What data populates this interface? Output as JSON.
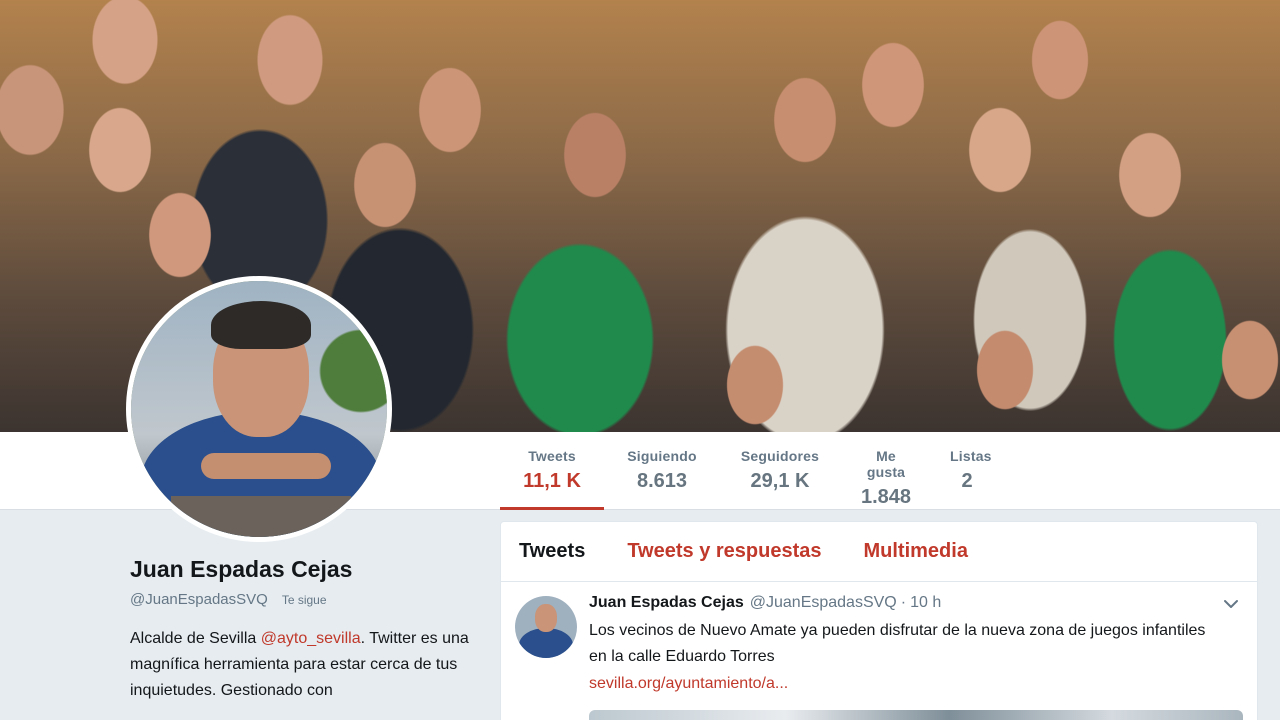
{
  "profile": {
    "name": "Juan Espadas Cejas",
    "handle": "@JuanEspadasSVQ",
    "follows_you": "Te sigue",
    "bio_prefix": "Alcalde de Sevilla ",
    "bio_mention": "@ayto_sevilla",
    "bio_suffix": ". Twitter es una magnífica herramienta para estar cerca de tus inquietudes. Gestionado con"
  },
  "stats": [
    {
      "label": "Tweets",
      "value": "11,1 K"
    },
    {
      "label": "Siguiendo",
      "value": "8.613"
    },
    {
      "label": "Seguidores",
      "value": "29,1 K"
    },
    {
      "label": "Me gusta",
      "value": "1.848"
    },
    {
      "label": "Listas",
      "value": "2"
    }
  ],
  "timeline": {
    "tabs": [
      "Tweets",
      "Tweets y respuestas",
      "Multimedia"
    ],
    "tweet": {
      "name": "Juan Espadas Cejas",
      "handle": "@JuanEspadasSVQ",
      "dot": "·",
      "time": "10 h",
      "text": "Los vecinos de Nuevo Amate ya pueden disfrutar de la nueva zona de juegos infantiles en la calle Eduardo Torres",
      "link": "sevilla.org/ayuntamiento/a..."
    }
  },
  "colors": {
    "accent": "#c0392b",
    "background": "#e6ecf0",
    "muted_text": "#657786"
  },
  "icons": {
    "tweet_menu": "chevron-down-icon"
  }
}
